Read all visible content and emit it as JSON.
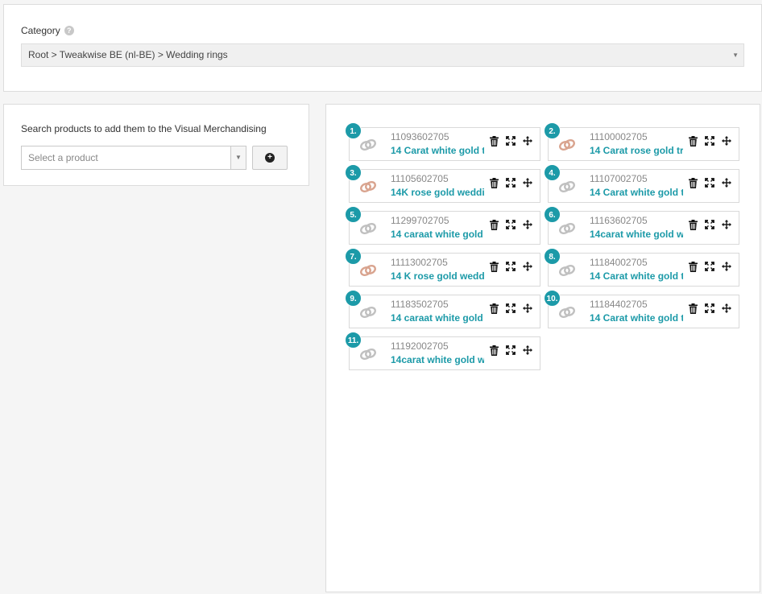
{
  "category": {
    "label": "Category",
    "help_icon": "question-icon",
    "value": "Root > Tweakwise BE (nl-BE) > Wedding rings"
  },
  "search": {
    "label": "Search products to add them to the Visual Merchandising",
    "placeholder": "Select a product",
    "add_icon": "plus-circle-icon"
  },
  "colors": {
    "accent": "#1c9aa8",
    "white_gold": "#c0c0c0",
    "rose_gold": "#d9a48f"
  },
  "products": [
    {
      "rank": "1.",
      "sku": "11093602705",
      "name": "14 Carat white gold t",
      "metal": "white"
    },
    {
      "rank": "2.",
      "sku": "11100002705",
      "name": "14 Carat rose gold tr",
      "metal": "rose"
    },
    {
      "rank": "3.",
      "sku": "11105602705",
      "name": "14K rose gold weddi",
      "metal": "rose"
    },
    {
      "rank": "4.",
      "sku": "11107002705",
      "name": "14 Carat white gold t",
      "metal": "white"
    },
    {
      "rank": "5.",
      "sku": "11299702705",
      "name": "14 caraat white gold",
      "metal": "white"
    },
    {
      "rank": "6.",
      "sku": "11163602705",
      "name": "14carat white gold w",
      "metal": "white"
    },
    {
      "rank": "7.",
      "sku": "11113002705",
      "name": "14 K rose gold wedd",
      "metal": "rose"
    },
    {
      "rank": "8.",
      "sku": "11184002705",
      "name": "14 Carat white gold t",
      "metal": "white"
    },
    {
      "rank": "9.",
      "sku": "11183502705",
      "name": "14 caraat white gold",
      "metal": "white"
    },
    {
      "rank": "10.",
      "sku": "11184402705",
      "name": "14 Carat white gold t",
      "metal": "white"
    },
    {
      "rank": "11.",
      "sku": "11192002705",
      "name": "14carat white gold w",
      "metal": "white"
    }
  ],
  "card_actions": [
    "trash-icon",
    "expand-icon",
    "move-icon"
  ]
}
